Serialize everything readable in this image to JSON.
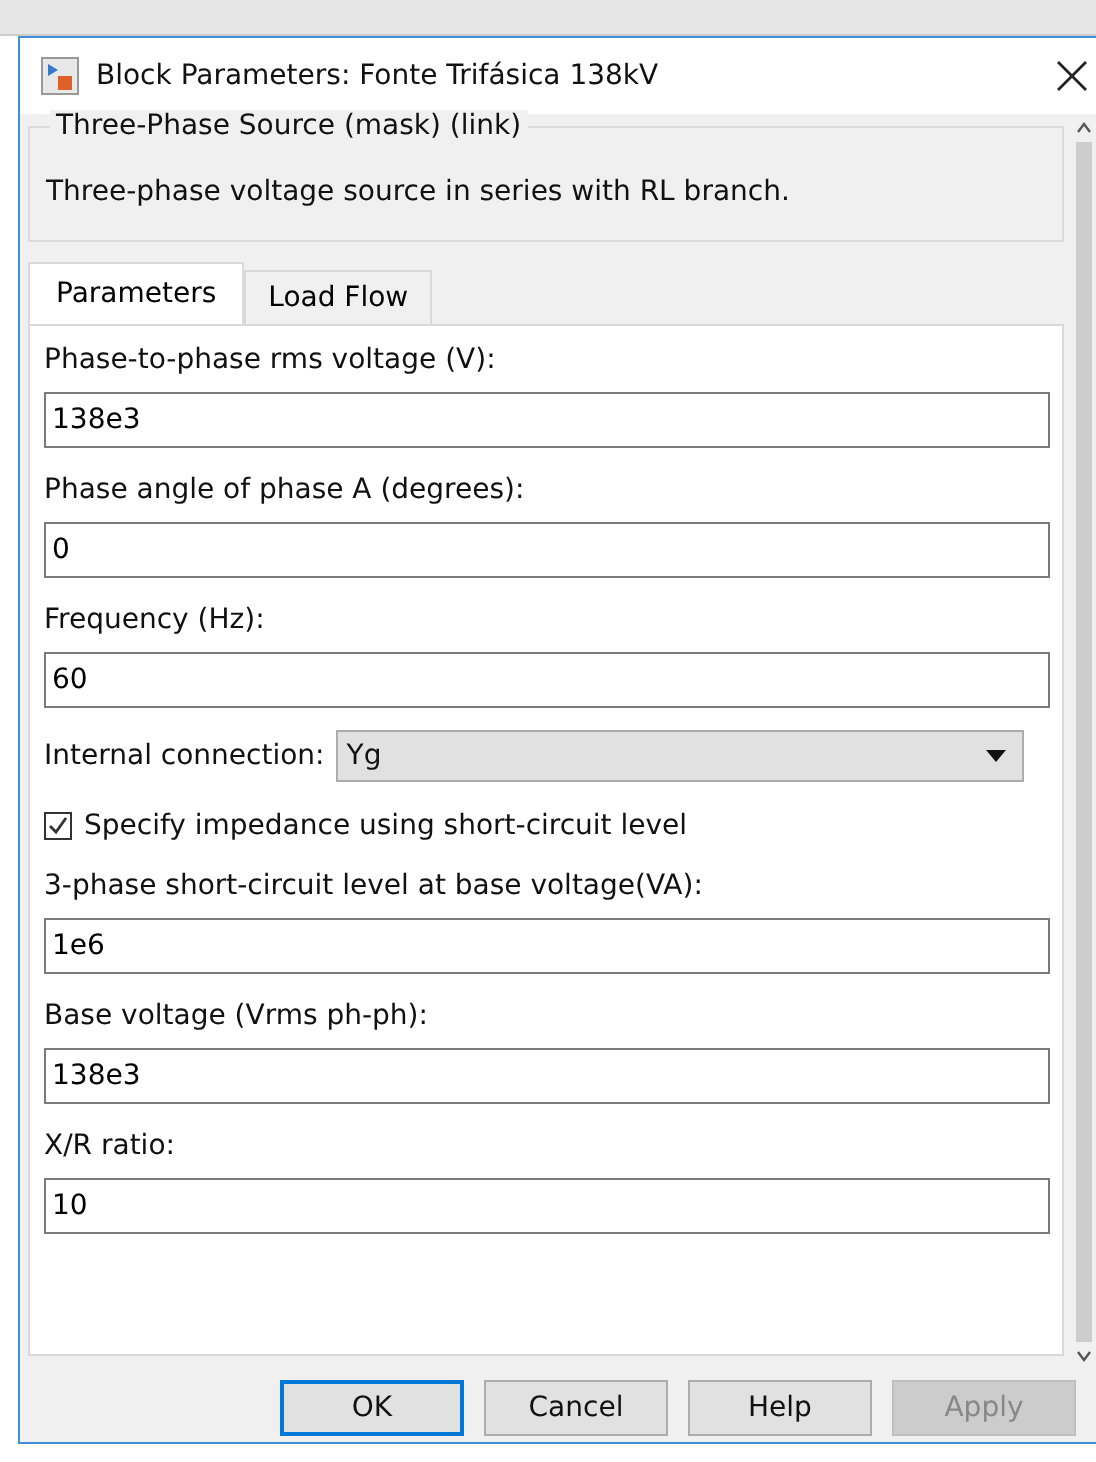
{
  "window": {
    "title": "Block Parameters: Fonte Trifásica 138kV"
  },
  "mask": {
    "title": "Three-Phase Source (mask) (link)",
    "description": "Three-phase voltage source in series with RL branch."
  },
  "tabs": [
    {
      "label": "Parameters",
      "selected": true
    },
    {
      "label": "Load Flow",
      "selected": false
    }
  ],
  "parameters": [
    {
      "kind": "edit",
      "label": "Phase-to-phase rms voltage (V):",
      "value": "138e3"
    },
    {
      "kind": "edit",
      "label": "Phase angle of phase A (degrees):",
      "value": "0"
    },
    {
      "kind": "edit",
      "label": "Frequency (Hz):",
      "value": "60"
    },
    {
      "kind": "popup",
      "label": "Internal connection:",
      "value": "Yg"
    },
    {
      "kind": "checkbox",
      "label": "Specify impedance using short-circuit level",
      "checked": true
    },
    {
      "kind": "edit",
      "label": "3-phase short-circuit level at base voltage(VA):",
      "value": "1e6"
    },
    {
      "kind": "edit",
      "label": "Base voltage (Vrms ph-ph):",
      "value": "138e3"
    },
    {
      "kind": "edit",
      "label": "X/R ratio:",
      "value": "10"
    }
  ],
  "buttons": [
    {
      "label": "OK",
      "focused": true,
      "disabled": false
    },
    {
      "label": "Cancel",
      "focused": false,
      "disabled": false
    },
    {
      "label": "Help",
      "focused": false,
      "disabled": false
    },
    {
      "label": "Apply",
      "focused": false,
      "disabled": true
    }
  ]
}
